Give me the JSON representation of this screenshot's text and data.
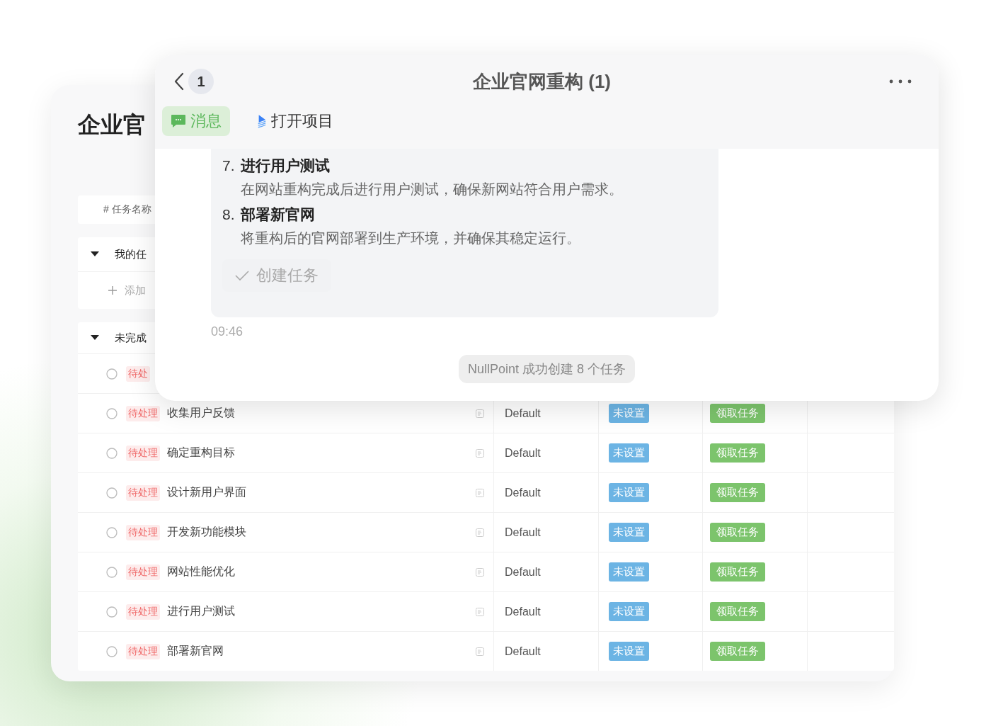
{
  "background_page": {
    "title": "企业官",
    "table_header": "# 任务名称",
    "groups": [
      {
        "label": "我的任",
        "expanded": true,
        "add_label": "添加"
      },
      {
        "label": "未完成",
        "expanded": true,
        "rows": [
          {
            "status": "待处"
          },
          {
            "status": "待处理",
            "name": "收集用户反馈",
            "project": "Default",
            "priority": "未设置",
            "action": "领取任务"
          },
          {
            "status": "待处理",
            "name": "确定重构目标",
            "project": "Default",
            "priority": "未设置",
            "action": "领取任务"
          },
          {
            "status": "待处理",
            "name": "设计新用户界面",
            "project": "Default",
            "priority": "未设置",
            "action": "领取任务"
          },
          {
            "status": "待处理",
            "name": "开发新功能模块",
            "project": "Default",
            "priority": "未设置",
            "action": "领取任务"
          },
          {
            "status": "待处理",
            "name": "网站性能优化",
            "project": "Default",
            "priority": "未设置",
            "action": "领取任务"
          },
          {
            "status": "待处理",
            "name": "进行用户测试",
            "project": "Default",
            "priority": "未设置",
            "action": "领取任务"
          },
          {
            "status": "待处理",
            "name": "部署新官网",
            "project": "Default",
            "priority": "未设置",
            "action": "领取任务"
          }
        ]
      }
    ]
  },
  "chat_window": {
    "badge": "1",
    "title": "企业官网重构 (1)",
    "tabs": [
      {
        "label": "消息",
        "selected": true,
        "kind": "message"
      },
      {
        "label": "打开项目",
        "selected": false,
        "kind": "project"
      }
    ],
    "message": {
      "items": [
        {
          "number": "7.",
          "title": "进行用户测试",
          "description": "在网站重构完成后进行用户测试，确保新网站符合用户需求。"
        },
        {
          "number": "8.",
          "title": "部署新官网",
          "description": "将重构后的官网部署到生产环境，并确保其稳定运行。"
        }
      ],
      "action": "创建任务",
      "time": "09:46"
    },
    "notice": "NullPoint 成功创建 8 个任务"
  }
}
